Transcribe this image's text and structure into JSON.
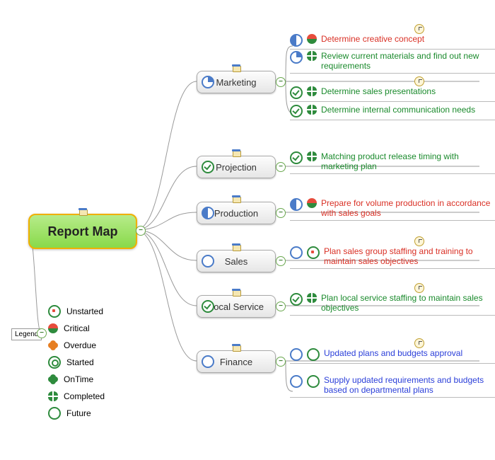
{
  "root": {
    "title": "Report Map"
  },
  "legend": {
    "title": "Legend",
    "items": [
      {
        "label": "Unstarted"
      },
      {
        "label": "Critical"
      },
      {
        "label": "Overdue"
      },
      {
        "label": "Started"
      },
      {
        "label": "OnTime"
      },
      {
        "label": "Completed"
      },
      {
        "label": "Future"
      }
    ]
  },
  "branches": {
    "marketing": {
      "label": "Marketing"
    },
    "projection": {
      "label": "Projection"
    },
    "production": {
      "label": "Production"
    },
    "sales": {
      "label": "Sales"
    },
    "local_service": {
      "label": "Local Service"
    },
    "finance": {
      "label": "Finance"
    }
  },
  "leaves": {
    "marketing": [
      {
        "text": "Determine creative concept",
        "color": "red",
        "prog": "half",
        "status": "critical",
        "clock": true
      },
      {
        "text": "Review current materials and find out new requirements",
        "color": "green",
        "prog": "quarter",
        "status": "completed",
        "clock": false
      },
      {
        "text": "Determine sales presentations",
        "color": "green",
        "prog": "done",
        "status": "completed",
        "clock": true
      },
      {
        "text": "Determine internal communication needs",
        "color": "green",
        "prog": "done",
        "status": "completed",
        "clock": false
      }
    ],
    "projection": [
      {
        "text": "Matching product release timing with marketing plan",
        "color": "green",
        "prog": "done",
        "status": "completed",
        "clock": false
      }
    ],
    "production": [
      {
        "text": "Prepare for volume production in accordance with sales goals",
        "color": "red",
        "prog": "half",
        "status": "critical",
        "clock": false
      }
    ],
    "sales": [
      {
        "text": "Plan sales group staffing and training to maintain sales objectives",
        "color": "red",
        "prog": "empty",
        "status": "unstarted",
        "clock": true
      }
    ],
    "local_service": [
      {
        "text": "Plan local service staffing to maintain sales objectives",
        "color": "green",
        "prog": "done",
        "status": "completed",
        "clock": true
      }
    ],
    "finance": [
      {
        "text": "Updated plans and budgets approval",
        "color": "blue",
        "prog": "empty",
        "status": "future",
        "clock": true
      },
      {
        "text": "Supply updated requirements and budgets based on departmental plans",
        "color": "blue",
        "prog": "empty",
        "status": "future",
        "clock": false
      }
    ]
  }
}
